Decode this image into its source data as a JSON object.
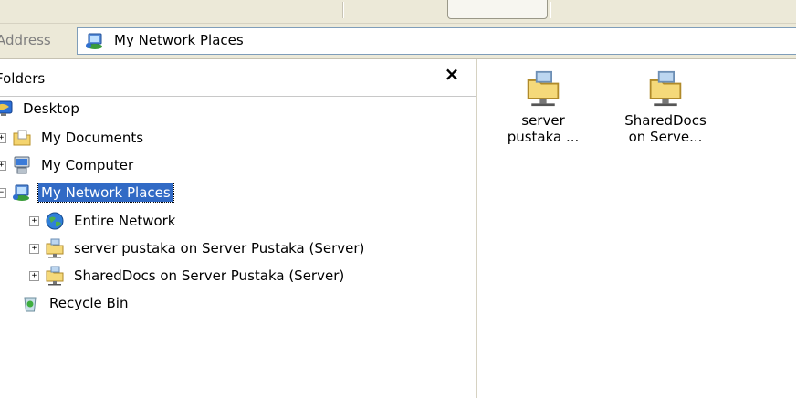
{
  "address": {
    "label": "Address",
    "value": "My Network Places",
    "icon": "network-places-icon"
  },
  "folders": {
    "title": "Folders",
    "close_label": "×",
    "items": [
      {
        "label": "Desktop",
        "icon": "desktop-icon",
        "expander": ""
      },
      {
        "label": "My Documents",
        "icon": "folder-documents-icon",
        "expander": "+"
      },
      {
        "label": "My Computer",
        "icon": "computer-icon",
        "expander": "+"
      },
      {
        "label": "My Network Places",
        "icon": "network-places-icon",
        "expander": "−",
        "selected": true
      },
      {
        "label": "Entire Network",
        "icon": "globe-icon",
        "expander": "+"
      },
      {
        "label": "server pustaka on Server Pustaka (Server)",
        "icon": "network-share-icon",
        "expander": "+"
      },
      {
        "label": "SharedDocs on Server Pustaka (Server)",
        "icon": "network-share-icon",
        "expander": "+"
      },
      {
        "label": "Recycle Bin",
        "icon": "recycle-bin-icon",
        "expander": ""
      }
    ]
  },
  "content": {
    "items": [
      {
        "line1": "server",
        "line2": "pustaka ...",
        "icon": "network-share-icon"
      },
      {
        "line1": "SharedDocs",
        "line2": "on Serve...",
        "icon": "network-share-icon"
      }
    ]
  }
}
